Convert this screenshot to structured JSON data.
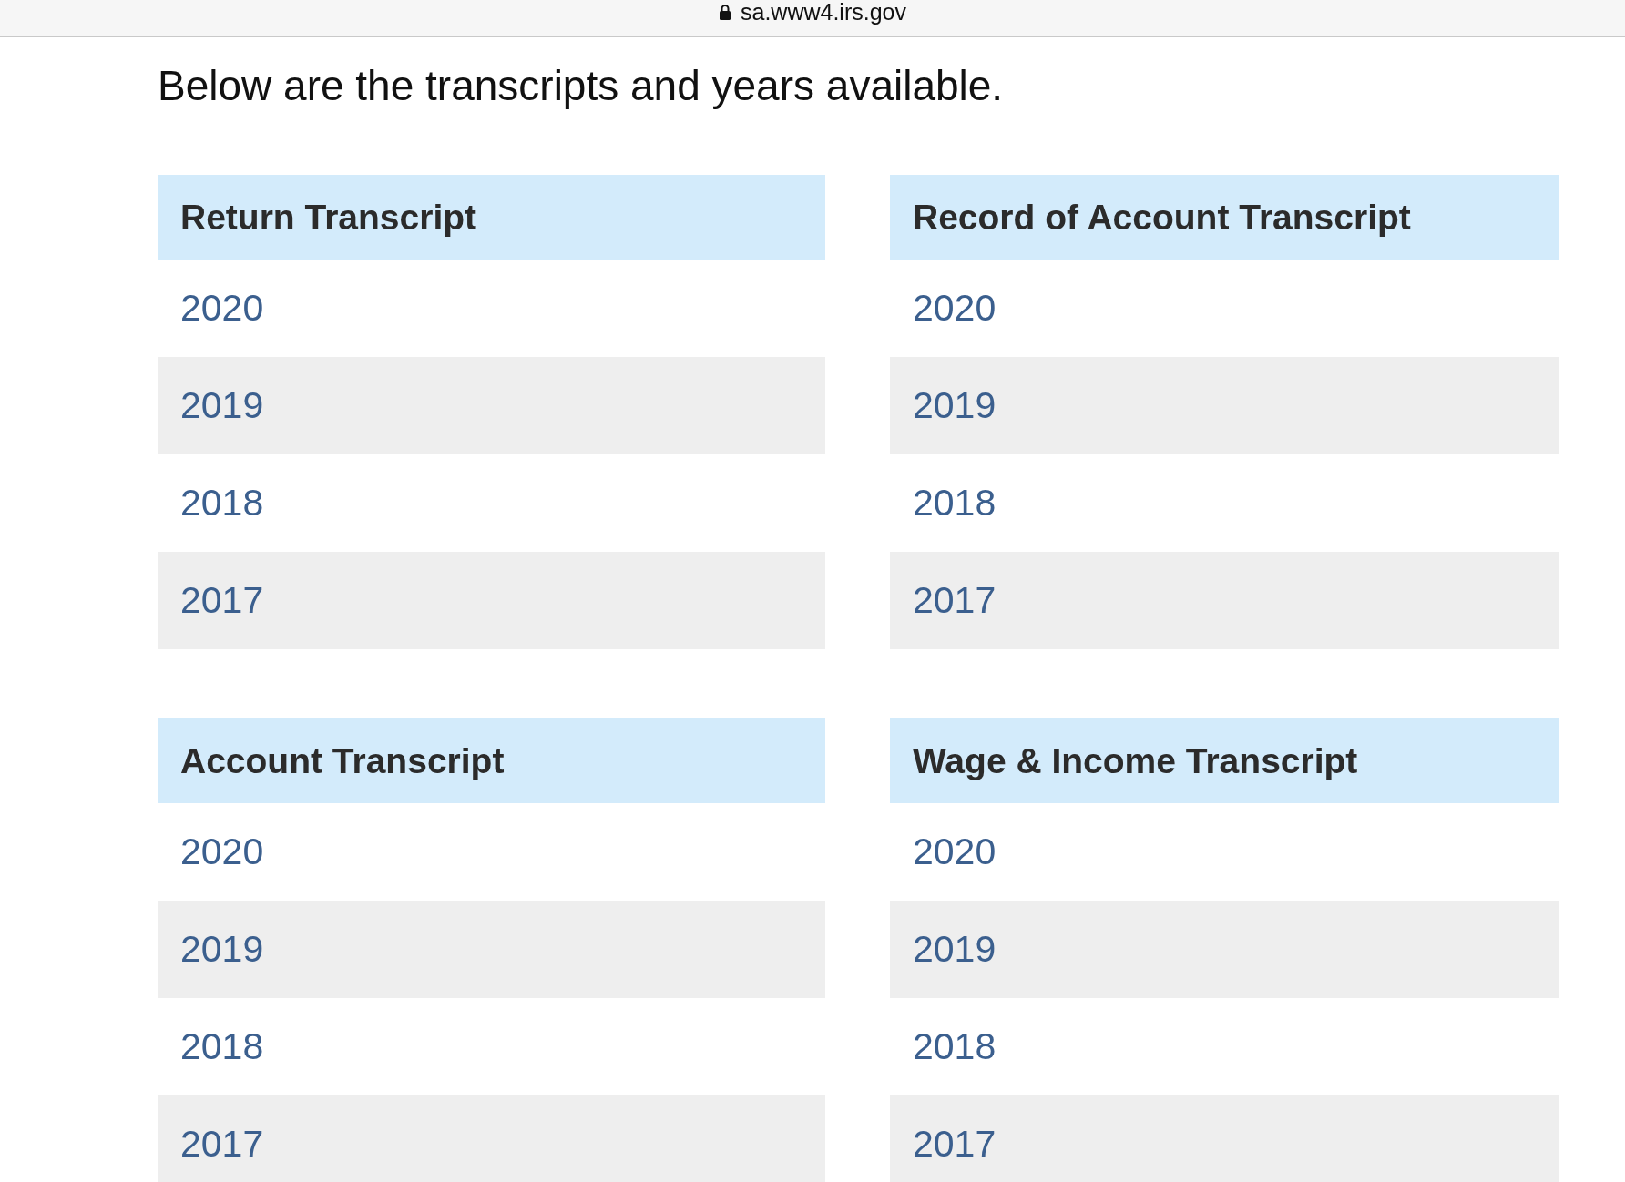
{
  "address_bar": {
    "url": "sa.www4.irs.gov"
  },
  "intro": "Below are the transcripts and years available.",
  "transcripts": [
    {
      "title": "Return Transcript",
      "years": [
        "2020",
        "2019",
        "2018",
        "2017"
      ]
    },
    {
      "title": "Record of Account Transcript",
      "years": [
        "2020",
        "2019",
        "2018",
        "2017"
      ]
    },
    {
      "title": "Account Transcript",
      "years": [
        "2020",
        "2019",
        "2018",
        "2017"
      ]
    },
    {
      "title": "Wage & Income Transcript",
      "years": [
        "2020",
        "2019",
        "2018",
        "2017"
      ]
    }
  ]
}
